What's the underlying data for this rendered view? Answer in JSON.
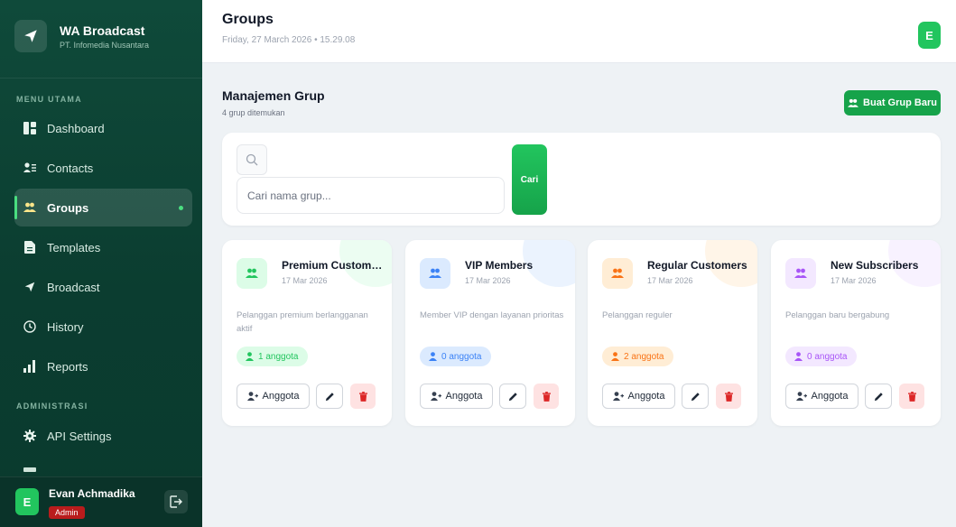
{
  "brand": {
    "name": "WA Broadcast",
    "subtitle": "PT. Infomedia Nusantara"
  },
  "sidebar": {
    "menu_label": "MENU UTAMA",
    "admin_label": "ADMINISTRASI",
    "items": [
      {
        "label": "Dashboard",
        "icon": "dashboard-icon"
      },
      {
        "label": "Contacts",
        "icon": "contacts-icon"
      },
      {
        "label": "Groups",
        "icon": "groups-icon",
        "active": true
      },
      {
        "label": "Templates",
        "icon": "templates-icon"
      },
      {
        "label": "Broadcast",
        "icon": "send-icon"
      },
      {
        "label": "History",
        "icon": "clock-icon"
      },
      {
        "label": "Reports",
        "icon": "bar-chart-icon"
      }
    ],
    "admin_items": [
      {
        "label": "API Settings",
        "icon": "gear-icon"
      }
    ]
  },
  "user": {
    "initial": "E",
    "name": "Evan Achmadika",
    "role": "Admin"
  },
  "header": {
    "title": "Groups",
    "datetime": "Friday, 27 March 2026 • 15.29.08",
    "avatar_initial": "E"
  },
  "section": {
    "title": "Manajemen Grup",
    "subtitle": "4 grup ditemukan",
    "create_button": "Buat Grup Baru"
  },
  "search": {
    "placeholder": "Cari nama grup...",
    "value": "",
    "button": "Cari"
  },
  "groups": [
    {
      "name": "Premium Customers",
      "date": "17 Mar 2026",
      "description": "Pelanggan premium berlangganan aktif",
      "members": "1 anggota",
      "accent": "#22c55e",
      "tint": "#dcfce7"
    },
    {
      "name": "VIP Members",
      "date": "17 Mar 2026",
      "description": "Member VIP dengan layanan prioritas",
      "members": "0 anggota",
      "accent": "#3b82f6",
      "tint": "#dbeafe"
    },
    {
      "name": "Regular Customers",
      "date": "17 Mar 2026",
      "description": "Pelanggan reguler",
      "members": "2 anggota",
      "accent": "#f97316",
      "tint": "#ffedd5"
    },
    {
      "name": "New Subscribers",
      "date": "17 Mar 2026",
      "description": "Pelanggan baru bergabung",
      "members": "0 anggota",
      "accent": "#a855f7",
      "tint": "#f3e8ff"
    }
  ],
  "card_actions": {
    "members_button": "Anggota"
  }
}
